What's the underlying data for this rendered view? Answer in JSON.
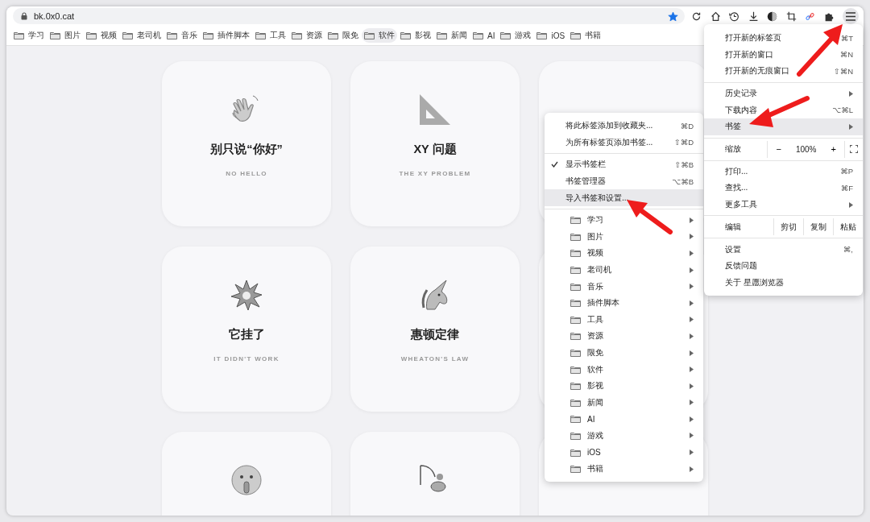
{
  "address_bar": {
    "url": "bk.0x0.cat",
    "bookmarked": true
  },
  "bookmarks_bar": [
    {
      "label": "学习",
      "selected": false
    },
    {
      "label": "图片",
      "selected": false
    },
    {
      "label": "视频",
      "selected": false
    },
    {
      "label": "老司机",
      "selected": false
    },
    {
      "label": "音乐",
      "selected": false
    },
    {
      "label": "插件脚本",
      "selected": false
    },
    {
      "label": "工具",
      "selected": false
    },
    {
      "label": "资源",
      "selected": false
    },
    {
      "label": "限免",
      "selected": false
    },
    {
      "label": "软件",
      "selected": true
    },
    {
      "label": "影视",
      "selected": false
    },
    {
      "label": "新闻",
      "selected": false
    },
    {
      "label": "AI",
      "selected": false
    },
    {
      "label": "游戏",
      "selected": false
    },
    {
      "label": "iOS",
      "selected": false
    },
    {
      "label": "书籍",
      "selected": false
    }
  ],
  "cards": [
    {
      "title": "别只说“你好”",
      "subtitle": "NO HELLO"
    },
    {
      "title": "XY 问题",
      "subtitle": "THE XY PROBLEM"
    },
    {
      "title": "它挂了",
      "subtitle": "IT DIDN'T WORK"
    },
    {
      "title": "惠顿定律",
      "subtitle": "WHEATON'S LAW"
    }
  ],
  "bookmarks_menu": [
    {
      "kind": "item",
      "label": "将此标签添加到收藏夹...",
      "shortcut": "⌘D",
      "checked": false,
      "selected": false
    },
    {
      "kind": "item",
      "label": "为所有标签页添加书签...",
      "shortcut": "⇧⌘D",
      "checked": false,
      "selected": false
    },
    {
      "kind": "separator"
    },
    {
      "kind": "item",
      "label": "显示书签栏",
      "shortcut": "⇧⌘B",
      "checked": true,
      "selected": false
    },
    {
      "kind": "item",
      "label": "书签管理器",
      "shortcut": "⌥⌘B",
      "checked": false,
      "selected": false
    },
    {
      "kind": "item",
      "label": "导入书签和设置...",
      "checked": false,
      "selected": true
    },
    {
      "kind": "separator"
    },
    {
      "kind": "folder",
      "label": "学习",
      "selected": false
    },
    {
      "kind": "folder",
      "label": "图片",
      "selected": false
    },
    {
      "kind": "folder",
      "label": "视频",
      "selected": false
    },
    {
      "kind": "folder",
      "label": "老司机",
      "selected": false
    },
    {
      "kind": "folder",
      "label": "音乐",
      "selected": false
    },
    {
      "kind": "folder",
      "label": "插件脚本",
      "selected": false
    },
    {
      "kind": "folder",
      "label": "工具",
      "selected": false
    },
    {
      "kind": "folder",
      "label": "资源",
      "selected": false
    },
    {
      "kind": "folder",
      "label": "限免",
      "selected": false
    },
    {
      "kind": "folder",
      "label": "软件",
      "selected": false
    },
    {
      "kind": "folder",
      "label": "影视",
      "selected": false
    },
    {
      "kind": "folder",
      "label": "新闻",
      "selected": false
    },
    {
      "kind": "folder",
      "label": "AI",
      "selected": false
    },
    {
      "kind": "folder",
      "label": "游戏",
      "selected": false
    },
    {
      "kind": "folder",
      "label": "iOS",
      "selected": false
    },
    {
      "kind": "folder",
      "label": "书籍",
      "selected": false
    }
  ],
  "main_menu": [
    {
      "kind": "item",
      "label": "打开新的标签页",
      "shortcut": "⌘T",
      "submenu": false,
      "selected": false
    },
    {
      "kind": "item",
      "label": "打开新的窗口",
      "shortcut": "⌘N",
      "submenu": false,
      "selected": false
    },
    {
      "kind": "item",
      "label": "打开新的无痕窗口",
      "shortcut": "⇧⌘N",
      "submenu": false,
      "selected": false
    },
    {
      "kind": "separator"
    },
    {
      "kind": "item",
      "label": "历史记录",
      "submenu": true,
      "selected": false
    },
    {
      "kind": "item",
      "label": "下载内容",
      "shortcut": "⌥⌘L",
      "submenu": false,
      "selected": false
    },
    {
      "kind": "item",
      "label": "书签",
      "submenu": true,
      "selected": true
    },
    {
      "kind": "separator"
    },
    {
      "kind": "zoom",
      "label": "缩放",
      "minus": "−",
      "value": "100%",
      "plus": "+"
    },
    {
      "kind": "separator"
    },
    {
      "kind": "item",
      "label": "打印...",
      "shortcut": "⌘P",
      "submenu": false,
      "selected": false
    },
    {
      "kind": "item",
      "label": "查找...",
      "shortcut": "⌘F",
      "submenu": false,
      "selected": false
    },
    {
      "kind": "item",
      "label": "更多工具",
      "submenu": true,
      "selected": false
    },
    {
      "kind": "separator"
    },
    {
      "kind": "edit",
      "label": "编辑",
      "actions": [
        "剪切",
        "复制",
        "粘贴"
      ]
    },
    {
      "kind": "separator"
    },
    {
      "kind": "item",
      "label": "设置",
      "shortcut": "⌘,",
      "submenu": false,
      "selected": false
    },
    {
      "kind": "item",
      "label": "反馈问题",
      "submenu": false,
      "selected": false
    },
    {
      "kind": "item",
      "label": "关于 星愿浏览器",
      "submenu": false,
      "selected": false
    }
  ]
}
